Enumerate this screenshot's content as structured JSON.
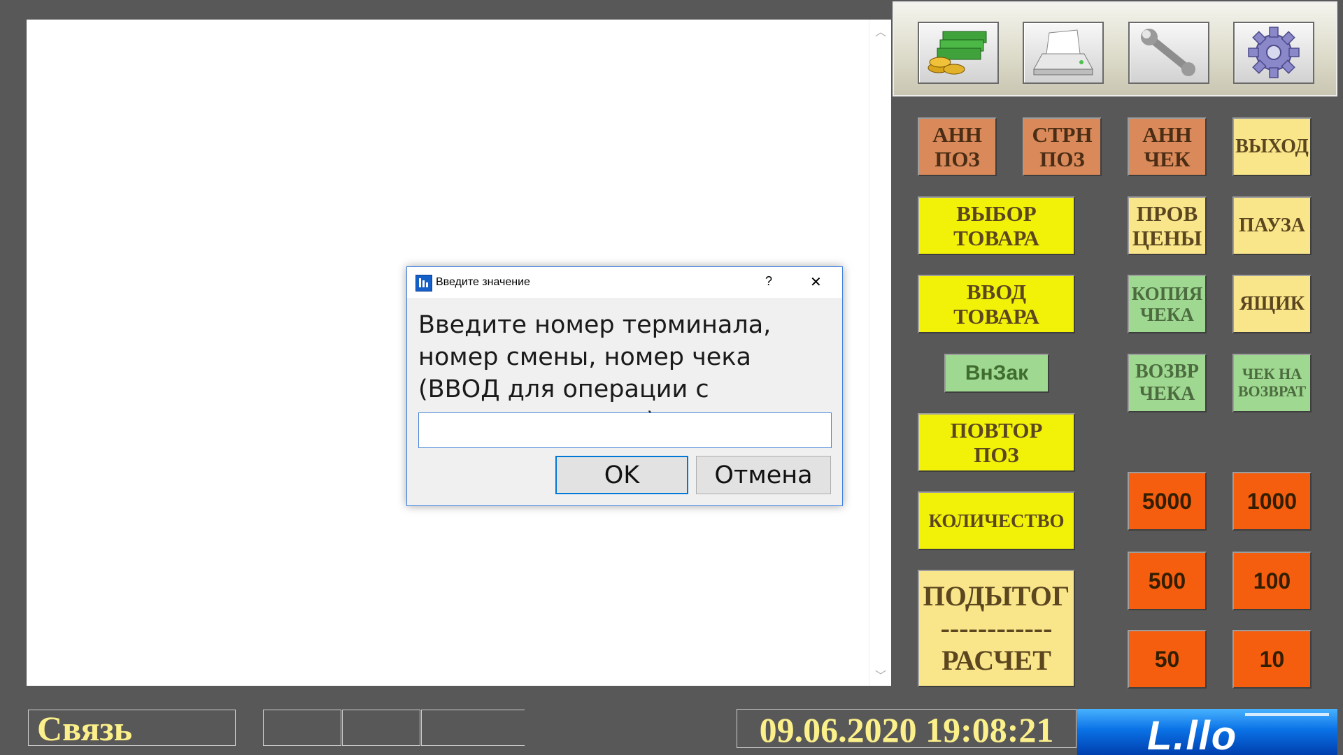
{
  "toolbar": {
    "buttons": [
      {
        "name": "money-icon"
      },
      {
        "name": "printer-icon"
      },
      {
        "name": "wrench-icon"
      },
      {
        "name": "gear-icon"
      }
    ]
  },
  "keys": {
    "ann_poz": "АНН\nПОЗ",
    "strn_poz": "СТРН\nПОЗ",
    "ann_cheka": "АНН\nЧЕК",
    "vykhod": "ВЫХОД",
    "vybor_tovara": "ВЫБОР\nТОВАРА",
    "prov_tseny": "ПРОВ\nЦЕНЫ",
    "pauza": "ПАУЗА",
    "vvod_tovara": "ВВОД\nТОВАРА",
    "kopiya_cheka": "КОПИЯ\nЧЕКА",
    "yashchik": "ЯЩИК",
    "vnzak": "ВнЗак",
    "vozvr_cheka": "ВОЗВР\nЧЕКА",
    "chek_na_vozvrat": "ЧЕК НА\nВОЗВРАТ",
    "povtor_poz": "ПОВТОР\nПОЗ",
    "kolichestvo": "КОЛИЧЕСТВО",
    "podytog": "ПОДЫТОГ\n------------\nРАСЧЕТ",
    "n5000": "5000",
    "n1000": "1000",
    "n500": "500",
    "n100": "100",
    "n50": "50",
    "n10": "10"
  },
  "dialog": {
    "title": "Введите значение",
    "help": "?",
    "close": "✕",
    "message": "Введите номер терминала, номер смены, номер чека (ВВОД для операции с последним чеком)",
    "input_value": "",
    "ok_label": "OK",
    "cancel_label": "Отмена"
  },
  "status": {
    "connection": "Связь",
    "datetime": "09.06.2020 19:08:21",
    "logo_text": "L.llo"
  },
  "colors": {
    "background": "#585858",
    "orange": "#d9895a",
    "pale_yellow": "#fae68a",
    "yellow": "#f2f209",
    "green": "#9fd890",
    "red": "#f55e0f",
    "status_text": "#fcf08a"
  }
}
